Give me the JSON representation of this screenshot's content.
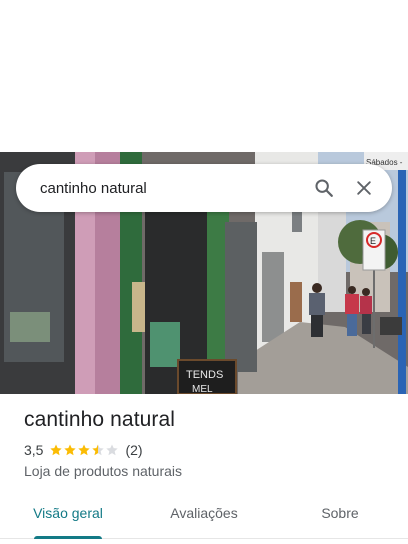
{
  "search": {
    "query": "cantinho natural"
  },
  "place": {
    "name": "cantinho natural",
    "rating_text": "3,5",
    "rating_value": 3.5,
    "max_stars": 5,
    "review_count": "(2)",
    "category": "Loja de produtos naturais"
  },
  "photo_signs": {
    "street_sign": "Sábados -",
    "parking_sign": "E",
    "board_sign": "TENDS\nMEL"
  },
  "tabs": [
    {
      "label": "Visão geral",
      "active": true
    },
    {
      "label": "Avaliações",
      "active": false
    },
    {
      "label": "Sobre",
      "active": false
    }
  ],
  "colors": {
    "accent": "#137a86",
    "star_filled": "#fbbc04",
    "star_empty": "#dadce0"
  },
  "icons": {
    "search": "search-icon",
    "close": "close-icon",
    "star": "star-icon"
  }
}
